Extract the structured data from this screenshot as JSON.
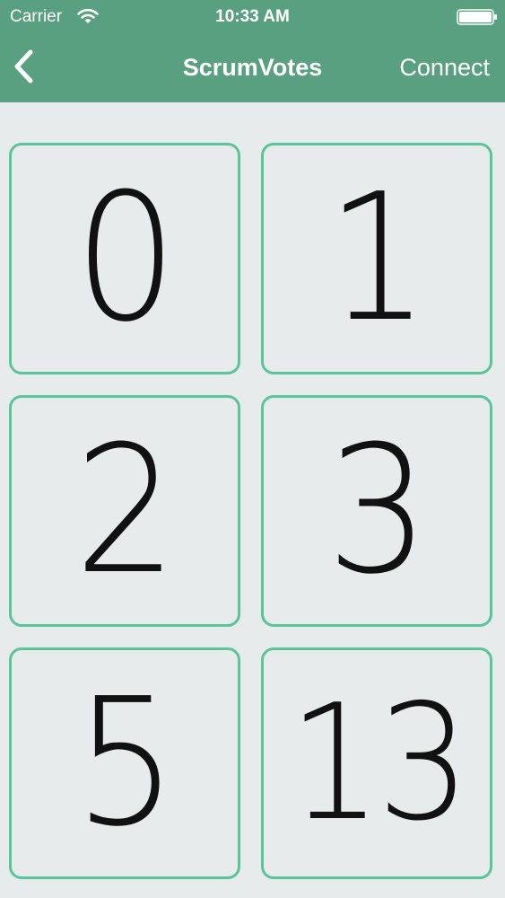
{
  "status_bar": {
    "carrier": "Carrier",
    "time": "10:33 AM",
    "icons": [
      "wifi-icon",
      "battery-icon"
    ]
  },
  "nav": {
    "back_icon": "chevron-left-icon",
    "title": "ScrumVotes",
    "connect_label": "Connect"
  },
  "colors": {
    "header": "#58a07f",
    "background": "#e8ebec",
    "card_border": "#5ac49a",
    "text": "#111111"
  },
  "votes": [
    {
      "value": "0"
    },
    {
      "value": "1"
    },
    {
      "value": "2"
    },
    {
      "value": "3"
    },
    {
      "value": "5"
    },
    {
      "value": "13"
    }
  ]
}
